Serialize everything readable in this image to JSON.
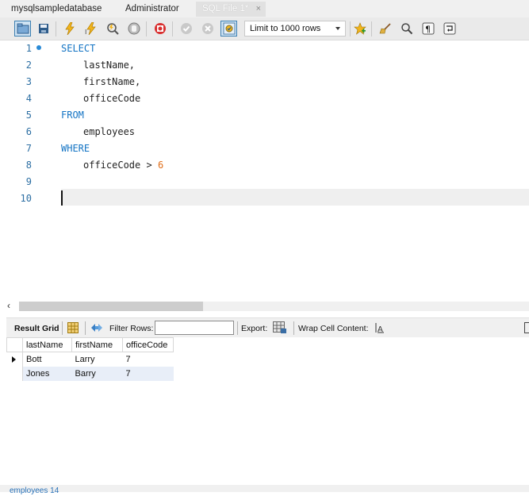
{
  "tabs": [
    {
      "label": "mysqlsampledatabase"
    },
    {
      "label": "Administrator"
    },
    {
      "label": "SQL File 1*",
      "close": "×"
    }
  ],
  "toolbar": {
    "limit_select": "Limit to 1000 rows"
  },
  "editor": {
    "line_numbers": [
      "1",
      "2",
      "3",
      "4",
      "5",
      "6",
      "7",
      "8",
      "9",
      "10"
    ],
    "keywords": {
      "select": "SELECT",
      "from": "FROM",
      "where": "WHERE"
    },
    "lines": {
      "l2": "lastName,",
      "l3": "firstName,",
      "l4": "officeCode",
      "l6": "employees",
      "l8_field": "officeCode",
      "l8_op": " > ",
      "l8_value": "6"
    }
  },
  "results_toolbar": {
    "result_grid": "Result Grid",
    "filter_rows": "Filter Rows:",
    "export": "Export:",
    "wrap_cell": "Wrap Cell Content:"
  },
  "grid": {
    "columns": [
      "lastName",
      "firstName",
      "officeCode"
    ],
    "rows": [
      [
        "Bott",
        "Larry",
        "7"
      ],
      [
        "Jones",
        "Barry",
        "7"
      ]
    ]
  },
  "bottom_tab": {
    "label": "employees 14"
  },
  "colors": {
    "keyword": "#1474c4",
    "number": "#e06e1a",
    "line_number": "#2d6fa3"
  }
}
